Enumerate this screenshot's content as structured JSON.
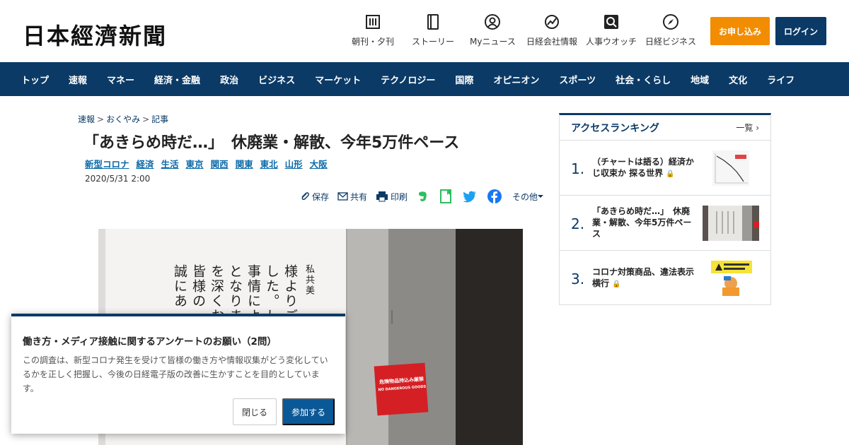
{
  "header": {
    "logo": "日本經濟新聞",
    "quicknav": [
      {
        "label": "朝刊・夕刊",
        "icon": "newspaper-icon"
      },
      {
        "label": "ストーリー",
        "icon": "book-icon"
      },
      {
        "label": "Myニュース",
        "icon": "user-icon"
      },
      {
        "label": "日経会社情報",
        "icon": "chart-icon"
      },
      {
        "label": "人事ウオッチ",
        "icon": "search-person-icon"
      },
      {
        "label": "日経ビジネス",
        "icon": "compass-icon"
      }
    ],
    "apply_label": "お申し込み",
    "login_label": "ログイン",
    "accent_orange": "#f28c00",
    "brand_navy": "#0b3a66"
  },
  "nav": {
    "items": [
      "トップ",
      "速報",
      "マネー",
      "経済・金融",
      "政治",
      "ビジネス",
      "マーケット",
      "テクノロジー",
      "国際",
      "オピニオン",
      "スポーツ",
      "社会・くらし",
      "地域",
      "文化",
      "ライフ"
    ]
  },
  "article": {
    "breadcrumb": [
      "速報",
      "おくやみ",
      "記事"
    ],
    "breadcrumb_sep": ">",
    "headline": "「あきらめ時だ…」　休廃業・解散、今年5万件ペース",
    "tags": [
      "新型コロナ",
      "経済",
      "生活",
      "東京",
      "関西",
      "関東",
      "東北",
      "山形",
      "大阪"
    ],
    "date": "2020/5/31 2:00",
    "tools": {
      "save": "保存",
      "share": "共有",
      "print": "印刷",
      "more": "その他"
    },
    "photo_notice_lines": [
      "私共美",
      "様よりご",
      "した。し",
      "事情によ",
      "となりま",
      "を深くお",
      "皆様の",
      "誠にあ"
    ],
    "photo_sign": "危険物品持込み厳禁",
    "photo_sign_en": "NO DANGEROUS GOODS"
  },
  "ranking": {
    "title": "アクセスランキング",
    "more": "一覧",
    "items": [
      {
        "rank": "1.",
        "title": "（チャートは語る）経済かじ収束か 探る世界",
        "locked": true
      },
      {
        "rank": "2.",
        "title": "「あきらめ時だ…」　休廃業・解散、今年5万件ペース",
        "locked": false
      },
      {
        "rank": "3.",
        "title": "コロナ対策商品、違法表示横行",
        "locked": true
      }
    ]
  },
  "survey": {
    "title": "働き方・メディア接触に関するアンケートのお願い（2問）",
    "body": "この調査は、新型コロナ発生を受けて皆様の働き方や情報収集がどう変化しているかを正しく把握し、今後の日経電子版の改善に生かすことを目的としています。",
    "close_label": "閉じる",
    "join_label": "参加する"
  }
}
